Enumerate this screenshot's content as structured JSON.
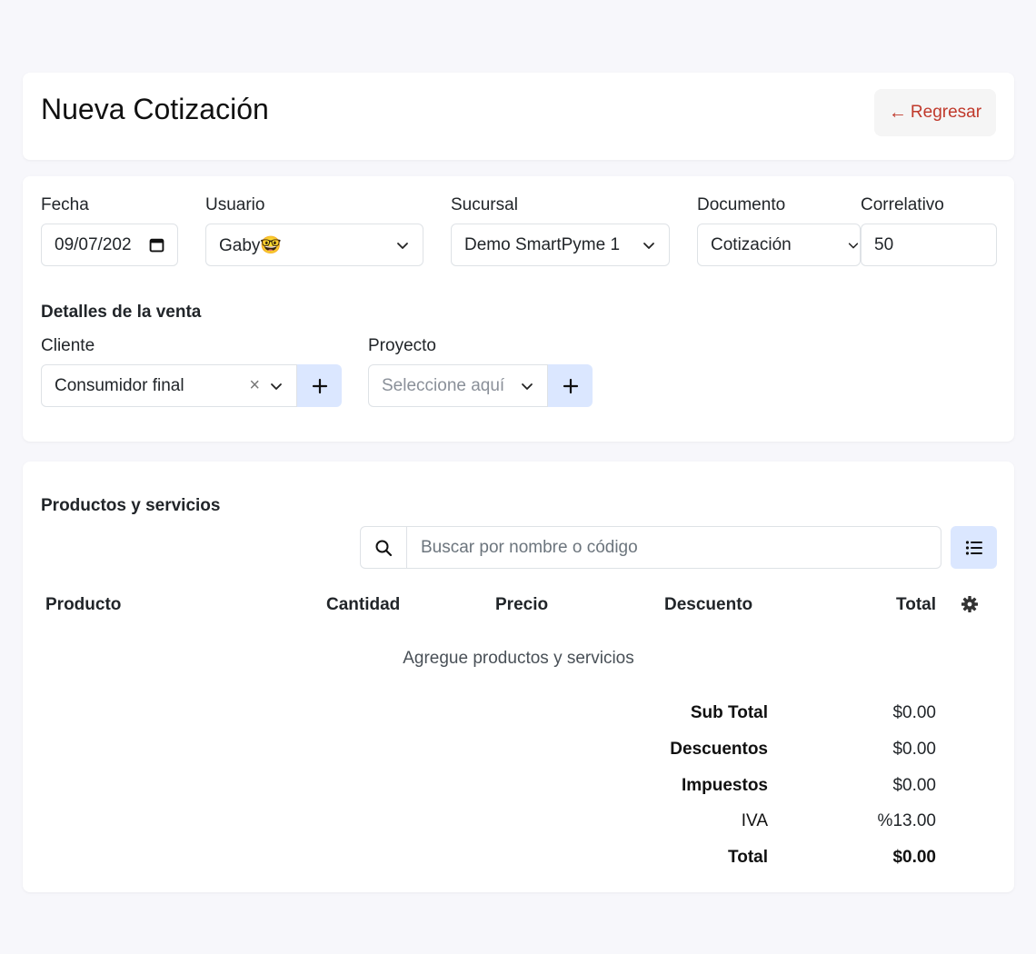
{
  "header": {
    "title": "Nueva Cotización",
    "back_label": "Regresar",
    "back_arrow": "←"
  },
  "form": {
    "fecha": {
      "label": "Fecha",
      "value": "09/07/202"
    },
    "usuario": {
      "label": "Usuario",
      "value": "Gaby🤓"
    },
    "sucursal": {
      "label": "Sucursal",
      "value": "Demo SmartPyme 1"
    },
    "documento": {
      "label": "Documento",
      "value": "Cotización"
    },
    "correlativo": {
      "label": "Correlativo",
      "value": "50"
    },
    "detalles_title": "Detalles de la venta",
    "cliente": {
      "label": "Cliente",
      "value": "Consumidor final",
      "clear": "×"
    },
    "proyecto": {
      "label": "Proyecto",
      "placeholder": "Seleccione aquí"
    },
    "plus_symbol": "+"
  },
  "products": {
    "title": "Productos y servicios",
    "search_placeholder": "Buscar por nombre o código",
    "columns": [
      "Producto",
      "Cantidad",
      "Precio",
      "Descuento",
      "Total"
    ],
    "empty_message": "Agregue productos y servicios",
    "totals": [
      {
        "label": "Sub Total",
        "value": "$0.00"
      },
      {
        "label": "Descuentos",
        "value": "$0.00"
      },
      {
        "label": "Impuestos",
        "value": "$0.00"
      },
      {
        "label": "IVA",
        "value": "%13.00"
      },
      {
        "label": "Total",
        "value": "$0.00"
      }
    ]
  },
  "colors": {
    "accent_light": "#dbe7ff",
    "back_text": "#c0392b",
    "background": "#f7f7fb"
  },
  "icons": {
    "back": "arrow-left-icon",
    "date": "calendar-icon",
    "dropdown": "chevron-down-icon",
    "add": "plus-icon",
    "search": "search-icon",
    "list": "list-icon",
    "settings": "gear-icon"
  }
}
